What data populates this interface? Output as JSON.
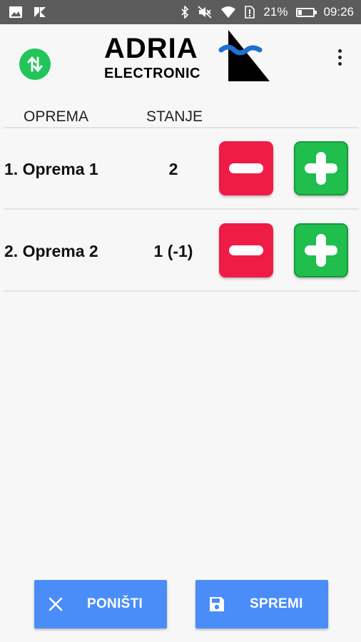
{
  "status_bar": {
    "battery_percent_text": "21%",
    "battery_level": 0.21,
    "time": "09:26",
    "icons": [
      "image-icon",
      "app-notification-icon",
      "bluetooth-icon",
      "mute-icon",
      "wifi-icon",
      "sim-alert-icon",
      "battery-icon"
    ]
  },
  "header": {
    "logo_line1": "ADRIA",
    "logo_line2": "ELECTRONIC",
    "sync_icon": "sync-arrows-icon",
    "menu_icon": "more-vert-icon"
  },
  "columns": {
    "equipment": "OPREMA",
    "state": "STANJE"
  },
  "items": [
    {
      "name": "1. Oprema 1",
      "state": "2"
    },
    {
      "name": "2. Oprema 2",
      "state": "1 (-1)"
    }
  ],
  "actions": {
    "cancel_label": "PONIŠTI",
    "save_label": "SPREMI"
  },
  "colors": {
    "status_bar": "#5c5c5c",
    "accent_green": "#21c55a",
    "minus_red": "#ef1c47",
    "plus_green": "#1fbe4d",
    "action_blue": "#4a8df8",
    "logo_blue": "#1f6fd1"
  }
}
